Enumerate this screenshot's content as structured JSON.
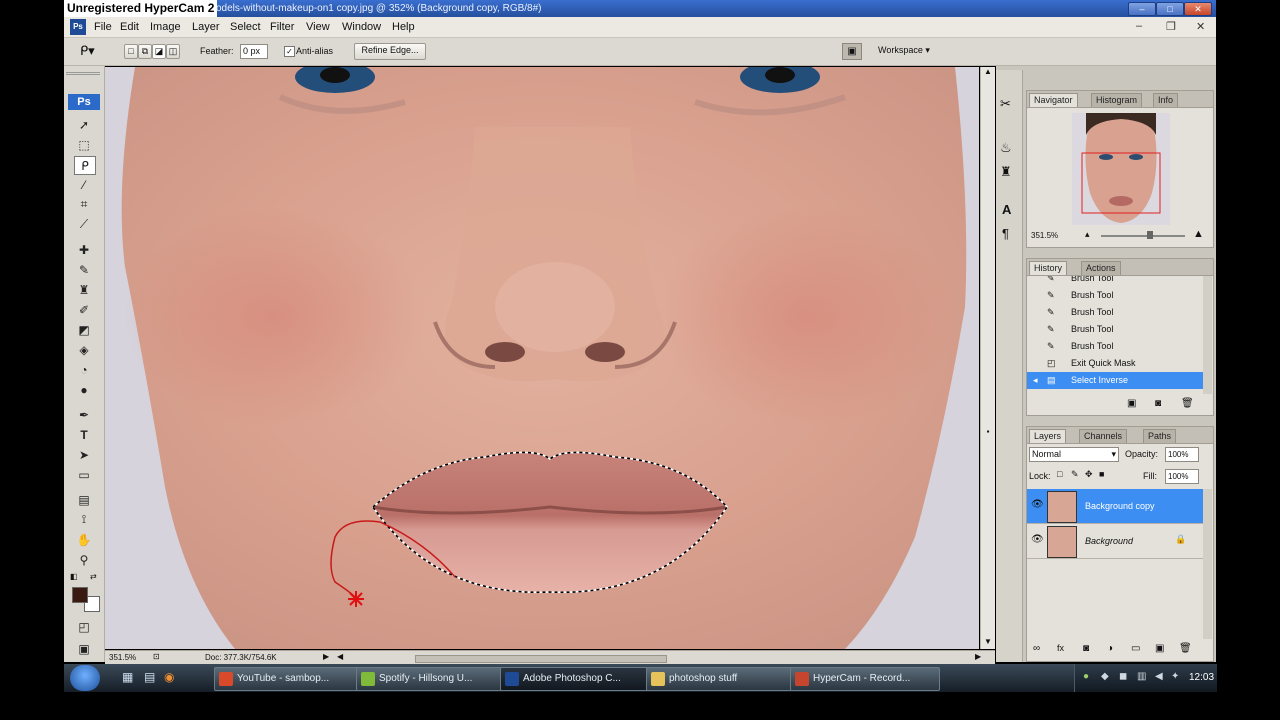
{
  "titlebar": {
    "hypercam_label": "Unregistered HyperCam 2",
    "document_title": "odels-without-makeup-on1 copy.jpg @ 352% (Background copy, RGB/8#)"
  },
  "menu": [
    "File",
    "Edit",
    "Image",
    "Layer",
    "Select",
    "Filter",
    "View",
    "Window",
    "Help"
  ],
  "options": {
    "feather_label": "Feather:",
    "feather_value": "0 px",
    "antialias_label": "Anti-alias",
    "refine_edge_label": "Refine Edge...",
    "workspace_label": "Workspace ▾"
  },
  "toolbox": {
    "logo": "Ps"
  },
  "navigator": {
    "tabs": [
      "Navigator",
      "Histogram",
      "Info"
    ],
    "zoom_value": "351.5%"
  },
  "history": {
    "tabs": [
      "History",
      "Actions"
    ],
    "items": [
      "Brush Tool",
      "Brush Tool",
      "Brush Tool",
      "Brush Tool",
      "Brush Tool",
      "Exit Quick Mask",
      "Select Inverse"
    ]
  },
  "layers": {
    "tabs": [
      "Layers",
      "Channels",
      "Paths"
    ],
    "blend_mode": "Normal",
    "opacity_label": "Opacity:",
    "opacity_value": "100%",
    "lock_label": "Lock:",
    "fill_label": "Fill:",
    "fill_value": "100%",
    "items": [
      {
        "name": "Background copy",
        "selected": true
      },
      {
        "name": "Background",
        "selected": false
      }
    ]
  },
  "statusbar": {
    "zoom": "351.5%",
    "doc_info": "Doc: 377.3K/754.6K"
  },
  "taskbar": {
    "tasks": [
      {
        "label": "YouTube - sambop...",
        "icon_color": "#d94a2a"
      },
      {
        "label": "Spotify - Hillsong U...",
        "icon_color": "#7fba3a"
      },
      {
        "label": "Adobe Photoshop C...",
        "icon_color": "#1f4a96"
      },
      {
        "label": "photoshop stuff",
        "icon_color": "#e6c35a"
      },
      {
        "label": "HyperCam - Record...",
        "icon_color": "#c5452e"
      }
    ],
    "clock": "12:03"
  },
  "colors": {
    "selection_blue": "#3d8ef2",
    "titlebar_blue": "#2a5cb4",
    "foreground_swatch": "#3a1a10"
  }
}
